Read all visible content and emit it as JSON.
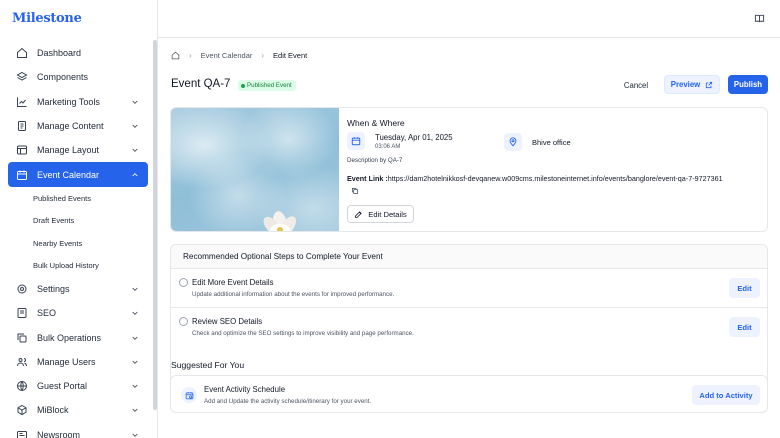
{
  "app": {
    "logo": "Milestone"
  },
  "sidebar": {
    "items": [
      {
        "label": "Dashboard",
        "icon": "home-icon",
        "expandable": false
      },
      {
        "label": "Components",
        "icon": "layers-icon",
        "expandable": false
      },
      {
        "label": "Marketing Tools",
        "icon": "chart-icon",
        "expandable": true
      },
      {
        "label": "Manage Content",
        "icon": "document-icon",
        "expandable": true
      },
      {
        "label": "Manage Layout",
        "icon": "layout-icon",
        "expandable": true
      },
      {
        "label": "Event Calendar",
        "icon": "calendar-icon",
        "expandable": true,
        "active": true
      },
      {
        "label": "Settings",
        "icon": "gear-icon",
        "expandable": true
      },
      {
        "label": "SEO",
        "icon": "seo-icon",
        "expandable": true
      },
      {
        "label": "Bulk Operations",
        "icon": "copy-icon",
        "expandable": true
      },
      {
        "label": "Manage Users",
        "icon": "users-icon",
        "expandable": true
      },
      {
        "label": "Guest Portal",
        "icon": "globe-icon",
        "expandable": true
      },
      {
        "label": "MiBlock",
        "icon": "cube-icon",
        "expandable": true
      },
      {
        "label": "Newsroom",
        "icon": "newspaper-icon",
        "expandable": true
      }
    ],
    "event_calendar_sub": [
      "Published Events",
      "Draft Events",
      "Nearby Events",
      "Bulk Upload History"
    ]
  },
  "breadcrumb": {
    "items": [
      "Event Calendar",
      "Edit Event"
    ]
  },
  "header": {
    "title": "Event QA-7",
    "status": "Published Event",
    "cancel": "Cancel",
    "preview": "Preview",
    "publish": "Publish"
  },
  "event": {
    "section_title": "When & Where",
    "date": "Tuesday, Apr 01, 2025",
    "time": "03:06 AM",
    "location": "Bhive office",
    "description": "Description by QA-7",
    "link_label": "Event Link :",
    "link_url": "https://dam2hotelnikkosf-devqanew.w009cms.milestoneinternet.info/events/banglore/event-qa-7-9727361",
    "edit_details": "Edit Details"
  },
  "steps": {
    "title": "Recommended Optional Steps to Complete Your Event",
    "items": [
      {
        "title": "Edit More Event Details",
        "desc": "Update additional information about the events for improved performance.",
        "button": "Edit"
      },
      {
        "title": "Review SEO Details",
        "desc": "Check and optimize the SEO settings to improve visibility and page performance.",
        "button": "Edit"
      }
    ]
  },
  "suggested": {
    "title": "Suggested For You",
    "item": {
      "title": "Event Activity Schedule",
      "desc": "Add and Update the activity schedule/itinerary for your event.",
      "button": "Add to Activity"
    }
  },
  "colors": {
    "accent": "#2563eb",
    "success": "#16a34a"
  }
}
